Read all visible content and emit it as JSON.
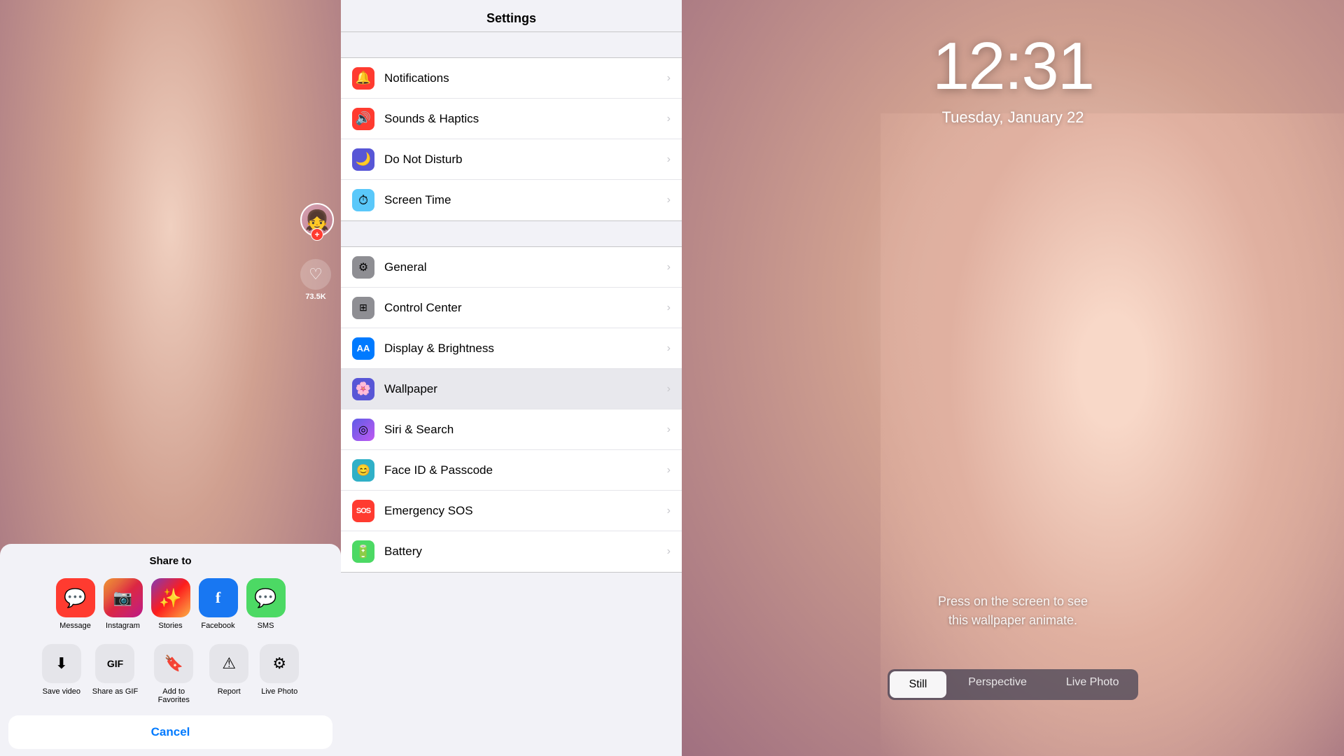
{
  "left": {
    "share_title": "Share to",
    "apps": [
      {
        "id": "message",
        "label": "Message",
        "icon": "💬",
        "class": "icon-message"
      },
      {
        "id": "instagram",
        "label": "Instagram",
        "icon": "📷",
        "class": "icon-instagram"
      },
      {
        "id": "stories",
        "label": "Stories",
        "icon": "✨",
        "class": "icon-stories"
      },
      {
        "id": "facebook",
        "label": "Facebook",
        "icon": "f",
        "class": "icon-facebook"
      },
      {
        "id": "sms",
        "label": "SMS",
        "icon": "💬",
        "class": "icon-sms"
      }
    ],
    "actions": [
      {
        "id": "save",
        "label": "Save video",
        "icon": "⬇"
      },
      {
        "id": "gif",
        "label": "Share as GIF",
        "icon": "GIF"
      },
      {
        "id": "favorites",
        "label": "Add to Favorites",
        "icon": "🔖"
      },
      {
        "id": "report",
        "label": "Report",
        "icon": "⚠"
      },
      {
        "id": "livephoto",
        "label": "Live Photo",
        "icon": "⚙"
      }
    ],
    "cancel_label": "Cancel",
    "like_count": "73.5K"
  },
  "settings": {
    "title": "Settings",
    "groups": [
      {
        "items": [
          {
            "id": "notifications",
            "label": "Notifications",
            "icon": "🔔",
            "icon_class": "icon-notif"
          },
          {
            "id": "sounds",
            "label": "Sounds & Haptics",
            "icon": "🔊",
            "icon_class": "icon-sound"
          },
          {
            "id": "dnd",
            "label": "Do Not Disturb",
            "icon": "🌙",
            "icon_class": "icon-dnd"
          },
          {
            "id": "screentime",
            "label": "Screen Time",
            "icon": "⏱",
            "icon_class": "icon-screentime"
          }
        ]
      },
      {
        "items": [
          {
            "id": "general",
            "label": "General",
            "icon": "⚙",
            "icon_class": "icon-general"
          },
          {
            "id": "control",
            "label": "Control Center",
            "icon": "⊞",
            "icon_class": "icon-control"
          },
          {
            "id": "display",
            "label": "Display & Brightness",
            "icon": "AA",
            "icon_class": "icon-display"
          },
          {
            "id": "wallpaper",
            "label": "Wallpaper",
            "icon": "🌸",
            "icon_class": "icon-wallpaper",
            "selected": true
          },
          {
            "id": "siri",
            "label": "Siri & Search",
            "icon": "◎",
            "icon_class": "icon-siri"
          },
          {
            "id": "faceid",
            "label": "Face ID & Passcode",
            "icon": "😊",
            "icon_class": "icon-faceid"
          },
          {
            "id": "sos",
            "label": "Emergency SOS",
            "icon": "SOS",
            "icon_class": "icon-sos"
          },
          {
            "id": "battery",
            "label": "Battery",
            "icon": "🔋",
            "icon_class": "icon-battery"
          }
        ]
      }
    ]
  },
  "lockscreen": {
    "time": "12:31",
    "date": "Tuesday, January 22",
    "hint": "Press on the screen to see\nthis wallpaper animate.",
    "options": [
      {
        "id": "still",
        "label": "Still",
        "active": true
      },
      {
        "id": "perspective",
        "label": "Perspective",
        "active": false
      },
      {
        "id": "livephoto",
        "label": "Live Photo",
        "active": false
      }
    ]
  }
}
